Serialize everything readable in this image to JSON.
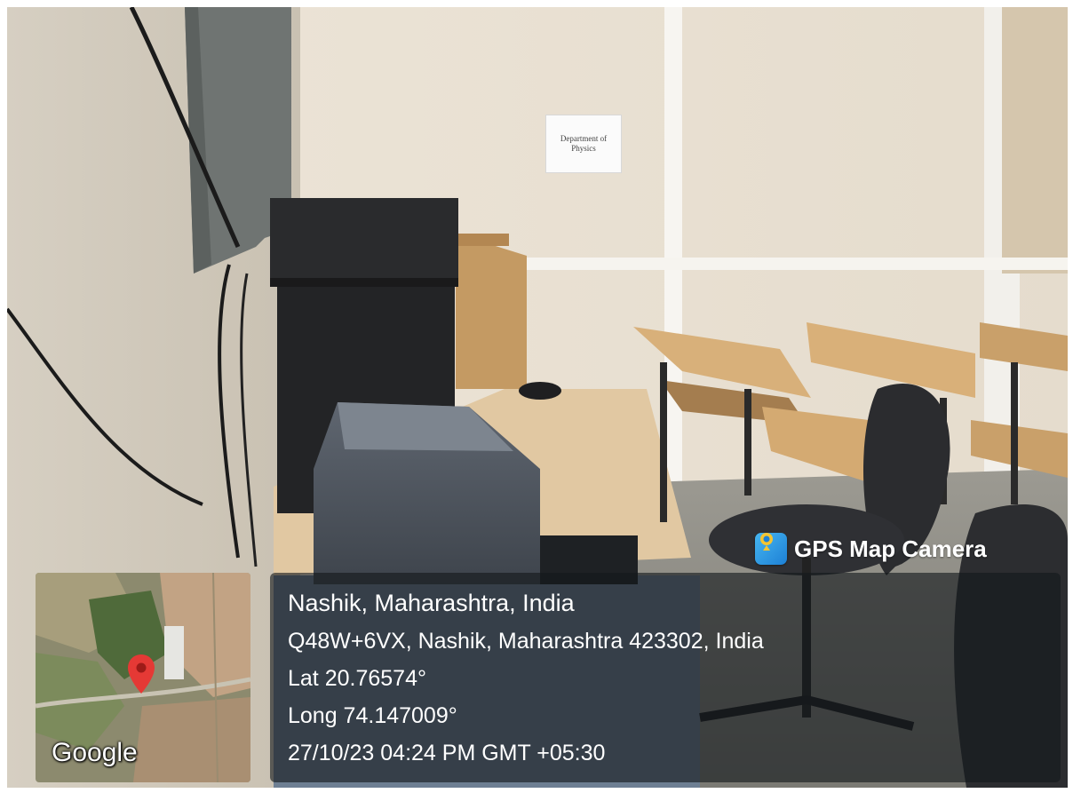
{
  "sign": {
    "line1": "Department of",
    "line2": "Physics"
  },
  "overlay": {
    "brand": "GPS Map Camera",
    "brand_icon": "map-camera-icon",
    "location": "Nashik, Maharashtra, India",
    "address": "Q48W+6VX, Nashik, Maharashtra 423302, India",
    "latitude": "Lat 20.76574°",
    "longitude": "Long 74.147009°",
    "datetime": "27/10/23 04:24 PM GMT +05:30"
  },
  "map": {
    "provider": "Google",
    "pin_icon": "location-pin-icon",
    "pin_color": "#e53935"
  }
}
